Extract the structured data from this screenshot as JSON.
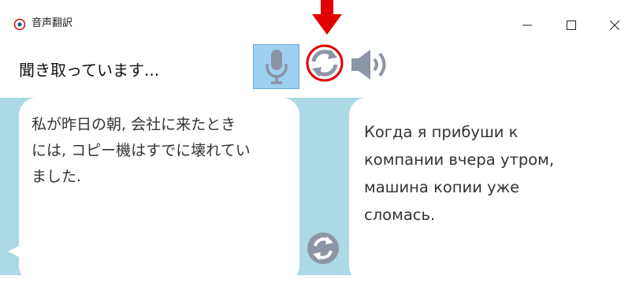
{
  "window": {
    "title": "音声翻訳",
    "minimize_glyph": "—",
    "maximize_glyph": "☐",
    "close_glyph": "✕"
  },
  "toolbar": {
    "status_text": "聞き取っています...",
    "mic_icon": "microphone-icon",
    "swap_direction_icon": "refresh-icon",
    "speaker_icon": "speaker-icon"
  },
  "panels": {
    "source_text": "私が昨日の朝, 会社に来たとき\nには, コピー機はすでに壊れてい\nました.",
    "target_text": "Когда я прибуши к\nкомпании вчера утром,\nмашина копии уже\nсломась."
  },
  "colors": {
    "content_bg": "#add8e6",
    "mic_active_bg": "#9ed0f0",
    "icon_gray": "#8c95a6",
    "annotation_red": "#e00000"
  }
}
